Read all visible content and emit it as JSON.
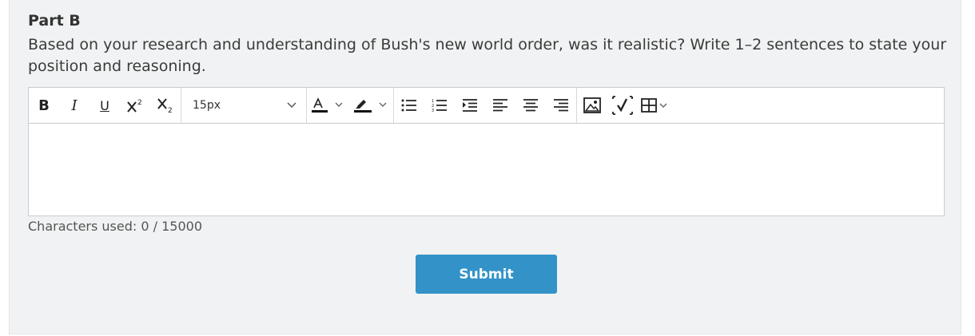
{
  "part_title": "Part B",
  "question": "Based on your research and understanding of Bush's new world order, was it realistic? Write 1–2 sentences to state your position and reasoning.",
  "toolbar": {
    "bold": "B",
    "italic": "I",
    "underline": "U",
    "font_size": "15px",
    "icons": [
      "bold-icon",
      "italic-icon",
      "underline-icon",
      "superscript-icon",
      "subscript-icon",
      "chevron-down-icon",
      "text-color-icon",
      "highlight-icon",
      "bullet-list-icon",
      "numbered-list-icon",
      "indent-icon",
      "align-left-icon",
      "align-center-icon",
      "align-right-icon",
      "image-icon",
      "equation-icon",
      "table-icon"
    ]
  },
  "char_count": "Characters used: 0 / 15000",
  "submit_label": "Submit",
  "colors": {
    "accent": "#3393c9",
    "background": "#f1f2f3"
  }
}
